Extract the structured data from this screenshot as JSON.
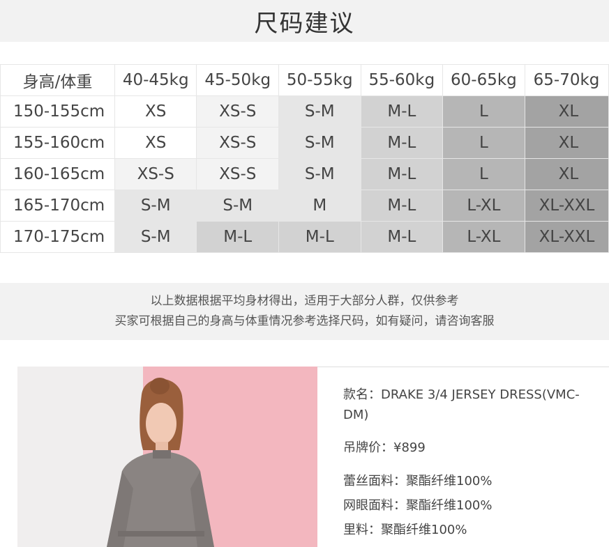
{
  "title": "尺码建议",
  "table": {
    "corner": "身高/体重",
    "columns": [
      "40-45kg",
      "45-50kg",
      "50-55kg",
      "55-60kg",
      "60-65kg",
      "65-70kg"
    ],
    "rows": [
      {
        "height": "150-155cm",
        "cells": [
          "XS",
          "XS-S",
          "S-M",
          "M-L",
          "L",
          "XL"
        ]
      },
      {
        "height": "155-160cm",
        "cells": [
          "XS",
          "XS-S",
          "S-M",
          "M-L",
          "L",
          "XL"
        ]
      },
      {
        "height": "160-165cm",
        "cells": [
          "XS-S",
          "XS-S",
          "S-M",
          "M-L",
          "L",
          "XL"
        ]
      },
      {
        "height": "165-170cm",
        "cells": [
          "S-M",
          "S-M",
          "M",
          "M-L",
          "L-XL",
          "XL-XXL"
        ]
      },
      {
        "height": "170-175cm",
        "cells": [
          "S-M",
          "M-L",
          "M-L",
          "M-L",
          "L-XL",
          "XL-XXL"
        ]
      }
    ]
  },
  "note": {
    "line1": "以上数据根据平均身材得出，适用于大部分人群，仅供参考",
    "line2": "买家可根据自己的身高与体重情况参考选择尺码，如有疑问，请咨询客服"
  },
  "product": {
    "name": "款名：DRAKE 3/4 JERSEY DRESS(VMC-DM)",
    "price": "吊牌价：¥899",
    "lace": "蕾丝面料：聚酯纤维100%",
    "mesh": "网眼面料：聚酯纤维100%",
    "lining": "里料：聚酯纤维100%"
  },
  "colors": {
    "band": "#f2f2f2",
    "pink": "#f3b7bf",
    "dress": "#8a8482"
  }
}
